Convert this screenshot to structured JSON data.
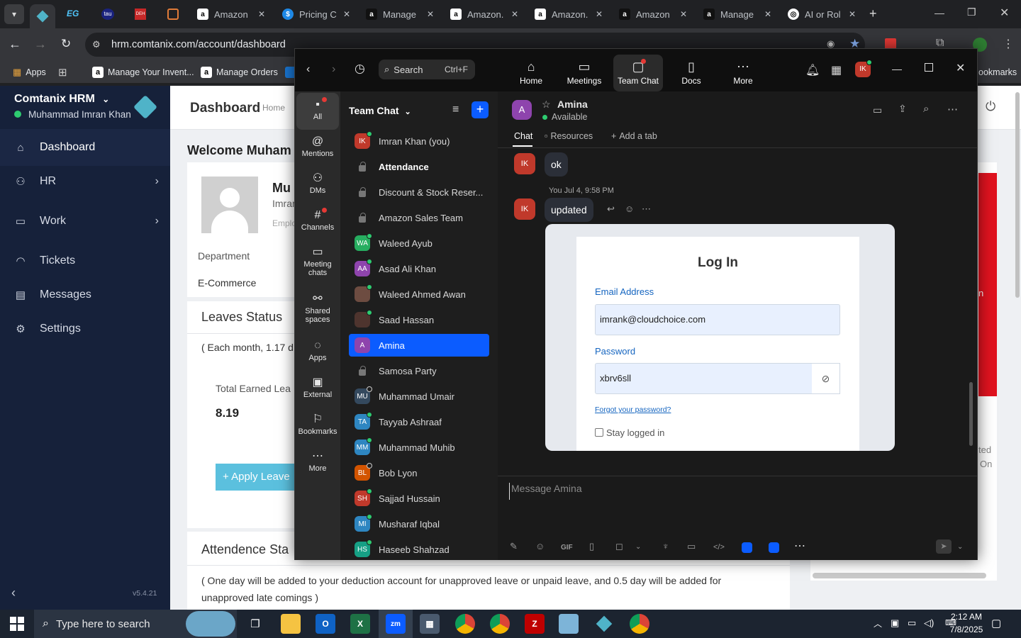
{
  "browser": {
    "tabs": [
      {
        "title": "Amazon",
        "icon": "amazon-icon"
      },
      {
        "title": "Pricing C",
        "icon": "dollar-icon"
      },
      {
        "title": "Manage",
        "icon": "amazon-icon"
      },
      {
        "title": "Amazon.",
        "icon": "amazon-icon"
      },
      {
        "title": "Amazon.",
        "icon": "amazon-icon"
      },
      {
        "title": "Amazon",
        "icon": "amazon-icon"
      },
      {
        "title": "Manage",
        "icon": "amazon-icon"
      },
      {
        "title": "AI or Rol",
        "icon": "openai-icon"
      }
    ],
    "pinned_tabs": [
      "EG",
      "tau",
      "DEH"
    ],
    "url": "hrm.comtanix.com/account/dashboard",
    "bookmarks": [
      "Apps",
      "Manage Your Invent...",
      "Manage Orders"
    ],
    "bookmarks_right": "ookmarks"
  },
  "hrm": {
    "brand": "Comtanix HRM",
    "user": "Muhammad Imran Khan",
    "nav": [
      "Dashboard",
      "HR",
      "Work",
      "Tickets",
      "Messages",
      "Settings"
    ],
    "version": "v5.4.21",
    "page_title": "Dashboard",
    "breadcrumb": "Home",
    "welcome": "Welcome Muham",
    "profile_name": "Mu",
    "profile_sub": "Imrar",
    "profile_sub2": "Emplo",
    "department_label": "Department",
    "department_value": "E-Commerce",
    "leaves_title": "Leaves Status",
    "leaves_note": "( Each month, 1.17 d",
    "total_earned_label": "Total Earned Lea",
    "total_earned_value": "8.19",
    "apply_leave": "+ Apply Leave",
    "attendance_title": "Attendence Sta",
    "attendance_note": "( One day will be added to your deduction account for unapproved leave or unpaid leave, and 0.5 day will be added for unapproved late comings )",
    "right_frag1": "n",
    "right_frag2": "ted",
    "right_frag3": "On"
  },
  "zoom": {
    "search_placeholder": "Search",
    "search_shortcut": "Ctrl+F",
    "top_tabs": [
      "Home",
      "Meetings",
      "Team Chat",
      "Docs",
      "More"
    ],
    "avatar_initials": "IK",
    "rail": [
      "All",
      "Mentions",
      "DMs",
      "Channels",
      "Meeting chats",
      "Shared spaces",
      "Apps",
      "External",
      "Bookmarks",
      "More"
    ],
    "list_title": "Team Chat",
    "contacts": [
      {
        "name": "Imran Khan (you)",
        "initials": "IK",
        "color": "#c0392b",
        "status": "on",
        "type": "avatar"
      },
      {
        "name": "Attendance",
        "type": "lock",
        "bold": true
      },
      {
        "name": "Discount & Stock Reser...",
        "type": "lock"
      },
      {
        "name": "Amazon Sales Team",
        "type": "lock"
      },
      {
        "name": "Waleed Ayub",
        "initials": "WA",
        "color": "#27ae60",
        "status": "on",
        "type": "avatar"
      },
      {
        "name": "Asad Ali Khan",
        "initials": "AA",
        "color": "#8e44ad",
        "status": "on",
        "type": "avatar"
      },
      {
        "name": "Waleed Ahmed Awan",
        "initials": "",
        "color": "#6d4c41",
        "status": "on",
        "type": "avatar"
      },
      {
        "name": "Saad Hassan",
        "initials": "",
        "color": "#4e342e",
        "status": "on",
        "type": "avatar"
      },
      {
        "name": "Amina",
        "initials": "A",
        "color": "#8e44ad",
        "status": "",
        "type": "avatar",
        "selected": true
      },
      {
        "name": "Samosa Party",
        "type": "lock"
      },
      {
        "name": "Muhammad Umair",
        "initials": "MU",
        "color": "#34495e",
        "status": "off",
        "type": "avatar"
      },
      {
        "name": "Tayyab Ashraaf",
        "initials": "TA",
        "color": "#2e86c1",
        "status": "on",
        "type": "avatar"
      },
      {
        "name": "Muhammad Muhib",
        "initials": "MM",
        "color": "#2e86c1",
        "status": "on",
        "type": "avatar"
      },
      {
        "name": "Bob Lyon",
        "initials": "BL",
        "color": "#d35400",
        "status": "off",
        "type": "avatar"
      },
      {
        "name": "Sajjad Hussain",
        "initials": "SH",
        "color": "#c0392b",
        "status": "on",
        "type": "avatar"
      },
      {
        "name": "Musharaf Iqbal",
        "initials": "MI",
        "color": "#2e86c1",
        "status": "on",
        "type": "avatar"
      },
      {
        "name": "Haseeb Shahzad",
        "initials": "HS",
        "color": "#16a085",
        "status": "on",
        "type": "avatar"
      }
    ],
    "chat_name": "Amina",
    "chat_status": "Available",
    "chat_initial": "A",
    "chat_tabs": [
      "Chat",
      "Resources",
      "Add a tab"
    ],
    "messages": [
      {
        "initials": "IK",
        "text": "ok"
      },
      {
        "meta": "You Jul 4, 9:58 PM",
        "initials": "IK",
        "text": "updated"
      }
    ],
    "login": {
      "title": "Log In",
      "email_label": "Email Address",
      "email_value": "imrank@cloudchoice.com",
      "password_label": "Password",
      "password_value": "xbrv6sll",
      "forgot": "Forgot your password?",
      "stay": "Stay logged in"
    },
    "composer_placeholder": "Message Amina",
    "gif_label": "GIF"
  },
  "taskbar": {
    "search_placeholder": "Type here to search",
    "time": "2:12 AM",
    "date": "7/8/2025"
  },
  "colors": {
    "zoom_blue": "#0b5cff",
    "hrm_side": "#16213a",
    "apply_button": "#5bc0de"
  }
}
